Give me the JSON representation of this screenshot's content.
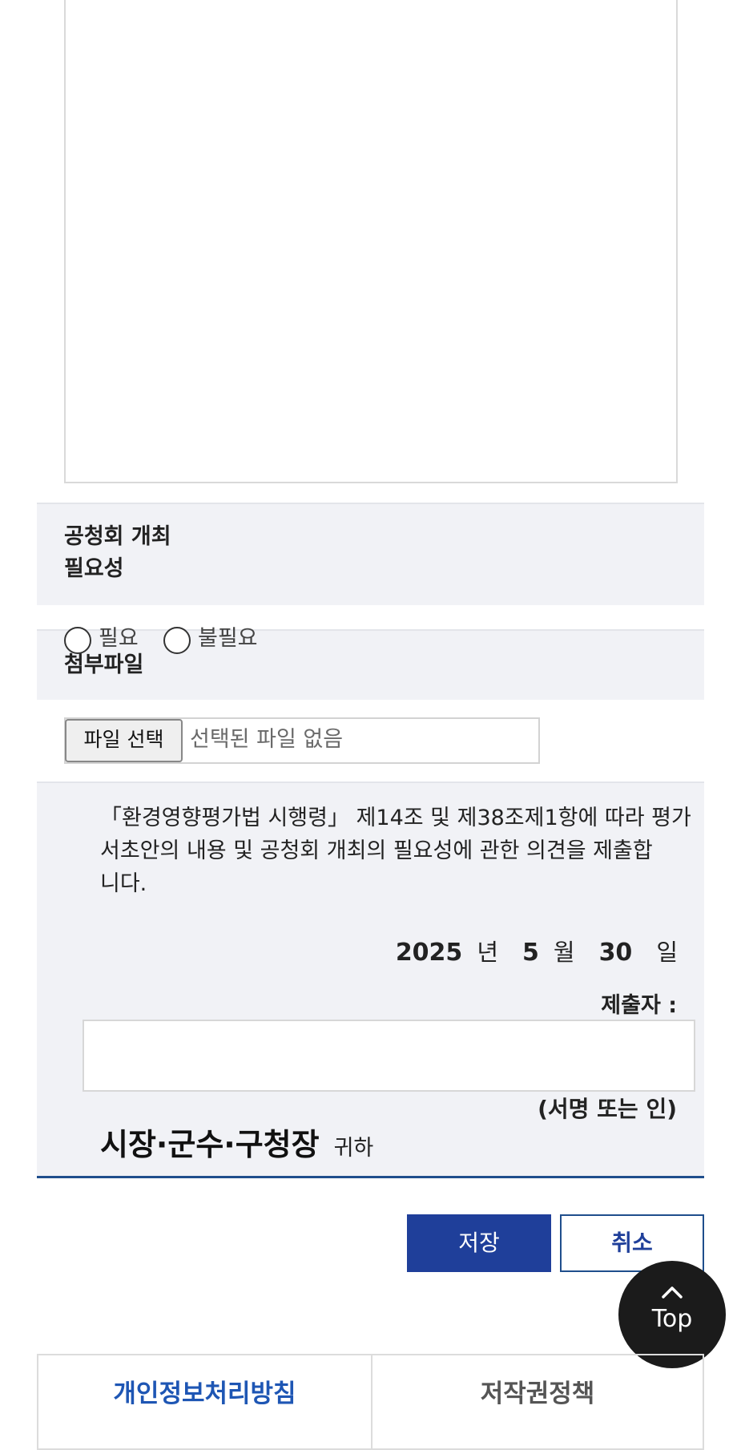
{
  "public_hearing": {
    "label_line1": "공청회 개최",
    "label_line2": "필요성",
    "options": [
      "필요",
      "불필요"
    ]
  },
  "attachment": {
    "label": "첨부파일",
    "button_label": "파일 선택",
    "status": "선택된 파일 없음"
  },
  "declaration": {
    "line1": "「환경영향평가법 시행령」 제14조 및 제38조제1항에 따라 평가",
    "line2": "서초안의 내용 및 공청회 개최의 필요성에 관한 의견을 제출합",
    "line3": "니다.",
    "date": {
      "year": "2025",
      "year_unit": "년",
      "month": "5",
      "month_unit": "월",
      "day": "30",
      "day_unit": "일"
    },
    "submitter_label": "제출자 :",
    "signature_note": "(서명 또는 인)",
    "recipient": "시장·군수·구청장",
    "recipient_suffix": "귀하"
  },
  "actions": {
    "save": "저장",
    "cancel": "취소"
  },
  "top_button": "Top",
  "footer": {
    "privacy": "개인정보처리방침",
    "copyright": "저작권정책"
  },
  "colors": {
    "primary": "#1f3f9a",
    "section_bg": "#f1f2f6",
    "footer_link": "#1e56b4"
  }
}
